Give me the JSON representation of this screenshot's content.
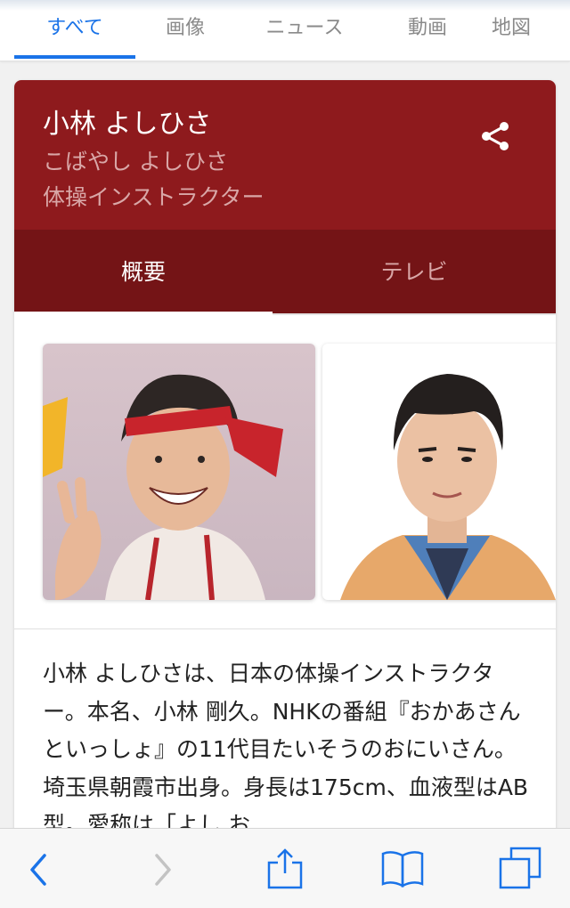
{
  "search_tabs": [
    {
      "label": "すべて",
      "active": true
    },
    {
      "label": "画像",
      "active": false
    },
    {
      "label": "ニュース",
      "active": false
    },
    {
      "label": "動画",
      "active": false
    },
    {
      "label": "地図",
      "active": false
    }
  ],
  "card": {
    "name": "小林 よしひさ",
    "reading": "こばやし よしひさ",
    "role": "体操インストラクター",
    "header_color": "#8e1a1d",
    "tabs": {
      "overview": "概要",
      "tv": "テレビ"
    },
    "share_icon": "share-icon",
    "description": "小林 よしひさは、日本の体操インストラクター。本名、小林 剛久。NHKの番組『おかあさんといっしょ』の11代目たいそうのおにいさん。埼玉県朝霞市出身。身長は175cm、血液型はAB型。愛称は「よし お"
  },
  "toolbar": {
    "icons": [
      "back-icon",
      "forward-icon",
      "share-icon",
      "bookmarks-icon",
      "tabs-icon"
    ],
    "accent": "#1a73e8"
  }
}
